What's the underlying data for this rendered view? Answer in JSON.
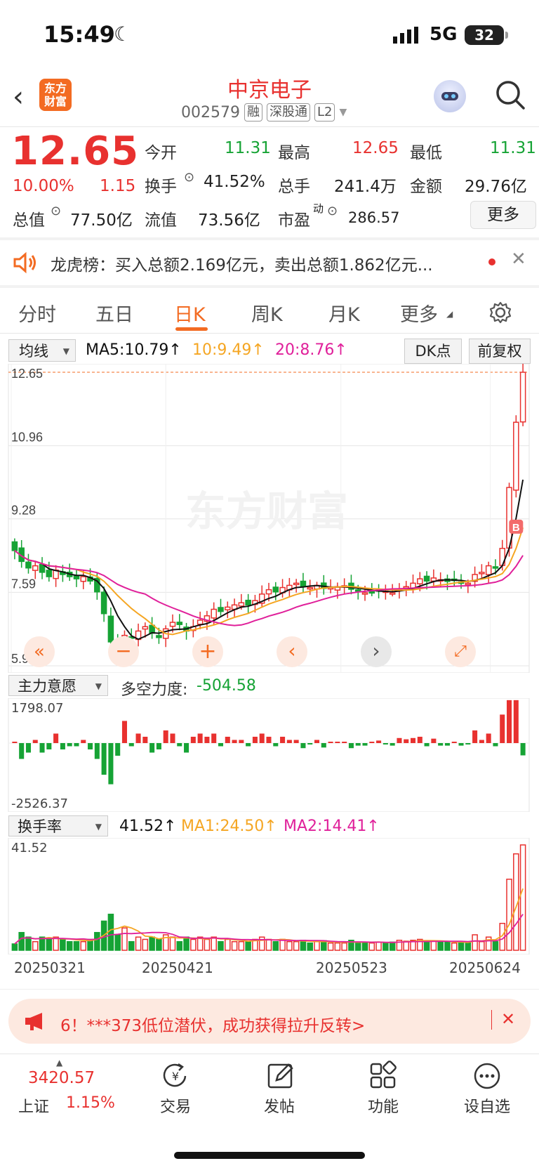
{
  "status_bar": {
    "time": "15:49",
    "network": "5G",
    "battery": "32"
  },
  "header": {
    "logo_text": "东方财富",
    "stock_name": "中京电子",
    "stock_code": "002579",
    "tags": [
      "融",
      "深股通",
      "L2"
    ]
  },
  "quote": {
    "price": "12.65",
    "change_pct": "10.00%",
    "change": "1.15",
    "open_label": "今开",
    "open": "11.31",
    "high_label": "最高",
    "high": "12.65",
    "low_label": "最低",
    "low": "11.31",
    "turnover_label": "换手",
    "turnover": "41.52%",
    "volume_label": "总手",
    "volume": "241.4万",
    "amount_label": "金额",
    "amount": "29.76亿",
    "mktcap_label": "总值",
    "mktcap": "77.50亿",
    "float_label": "流值",
    "float": "73.56亿",
    "pe_label": "市盈",
    "pe_sup": "动",
    "pe": "286.57",
    "more_label": "更多"
  },
  "dragon_tiger": {
    "text": "龙虎榜：买入总额2.169亿元，卖出总额1.862亿元..."
  },
  "tabs": [
    "分时",
    "五日",
    "日K",
    "周K",
    "月K",
    "更多"
  ],
  "ma_bar": {
    "select": "均线",
    "ma5": "MA5:10.79",
    "ma10": "10:9.49",
    "ma20": "20:8.76",
    "dk_label": "DK点",
    "fq_label": "前复权"
  },
  "price_axis": [
    "12.65",
    "10.96",
    "9.28",
    "7.59",
    "5.90"
  ],
  "watermark": "东方财富",
  "indicator1": {
    "select": "主力意愿",
    "label": "多空力度:",
    "value": "-504.58",
    "top": "1798.07",
    "bottom": "-2526.37"
  },
  "indicator2": {
    "select": "换手率",
    "value": "41.52",
    "ma1": "MA1:24.50",
    "ma2": "MA2:14.41",
    "top": "41.52"
  },
  "dates": [
    "20250321",
    "20250421",
    "20250523",
    "20250624"
  ],
  "banner": {
    "text": "6！***373低位潜伏，成功获得拉升反转>"
  },
  "bottom_nav": {
    "index_value": "3420.57",
    "index_name": "上证",
    "index_change": "1.15%",
    "items": [
      "交易",
      "发帖",
      "功能",
      "设自选"
    ]
  },
  "colors": {
    "up": "#e8312f",
    "down": "#16a335",
    "accent": "#f36b22",
    "ma5": "#111111",
    "ma10": "#f5a623",
    "ma20": "#e0209a"
  },
  "chart_data": [
    {
      "type": "candlestick",
      "title": "日K",
      "y_axis_labels": [
        12.65,
        10.96,
        9.28,
        7.59,
        5.9
      ],
      "ylim": [
        5.9,
        12.65
      ],
      "x_ticks": [
        "20250321",
        "20250421",
        "20250523",
        "20250624"
      ],
      "series": [
        {
          "name": "MA5",
          "last": 10.79
        },
        {
          "name": "MA10",
          "last": 9.49
        },
        {
          "name": "MA20",
          "last": 8.76
        }
      ],
      "close": [
        8.55,
        8.3,
        8.15,
        8.2,
        8.05,
        7.95,
        8.1,
        8.0,
        7.95,
        7.9,
        7.95,
        7.85,
        7.6,
        7.1,
        6.45,
        6.25,
        6.6,
        6.55,
        6.7,
        6.8,
        6.65,
        6.55,
        6.75,
        6.9,
        6.85,
        6.7,
        6.8,
        6.95,
        7.05,
        7.2,
        7.15,
        7.25,
        7.3,
        7.35,
        7.3,
        7.4,
        7.55,
        7.65,
        7.6,
        7.7,
        7.75,
        7.8,
        7.72,
        7.7,
        7.75,
        7.68,
        7.7,
        7.72,
        7.74,
        7.66,
        7.62,
        7.58,
        7.6,
        7.64,
        7.62,
        7.58,
        7.66,
        7.72,
        7.8,
        7.9,
        7.85,
        7.92,
        7.88,
        7.84,
        7.86,
        7.82,
        7.8,
        8.0,
        8.05,
        8.2,
        8.15,
        8.6,
        10.0,
        11.5,
        12.65
      ]
    },
    {
      "type": "bar",
      "title": "主力意愿",
      "ylim": [
        -2526.37,
        1798.07
      ],
      "label": "多空力度",
      "last": -504.58
    },
    {
      "type": "bar",
      "title": "换手率",
      "ylim": [
        0,
        41.52
      ],
      "series": [
        {
          "name": "MA1",
          "last": 24.5
        },
        {
          "name": "MA2",
          "last": 14.41
        }
      ],
      "last": 41.52
    }
  ]
}
